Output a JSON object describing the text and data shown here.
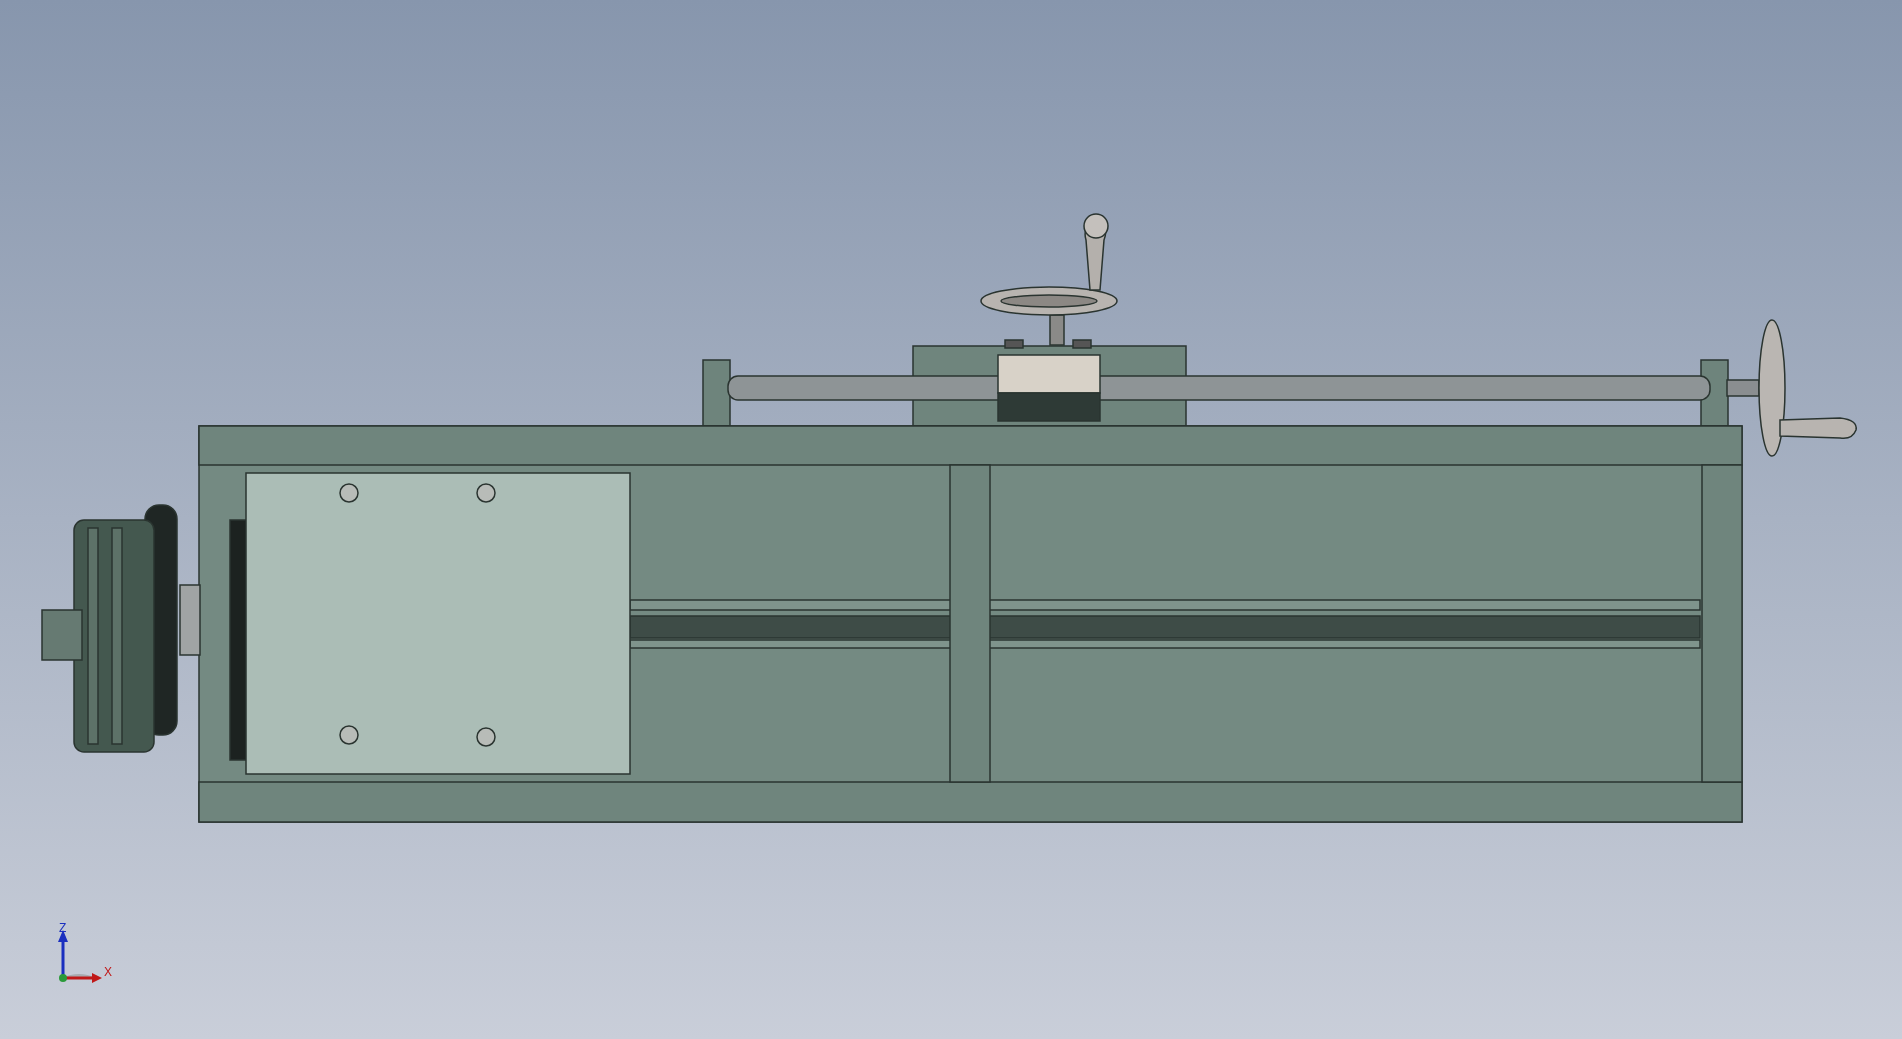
{
  "viewport": {
    "triad": {
      "z_label": "Z",
      "x_label": "X"
    }
  }
}
